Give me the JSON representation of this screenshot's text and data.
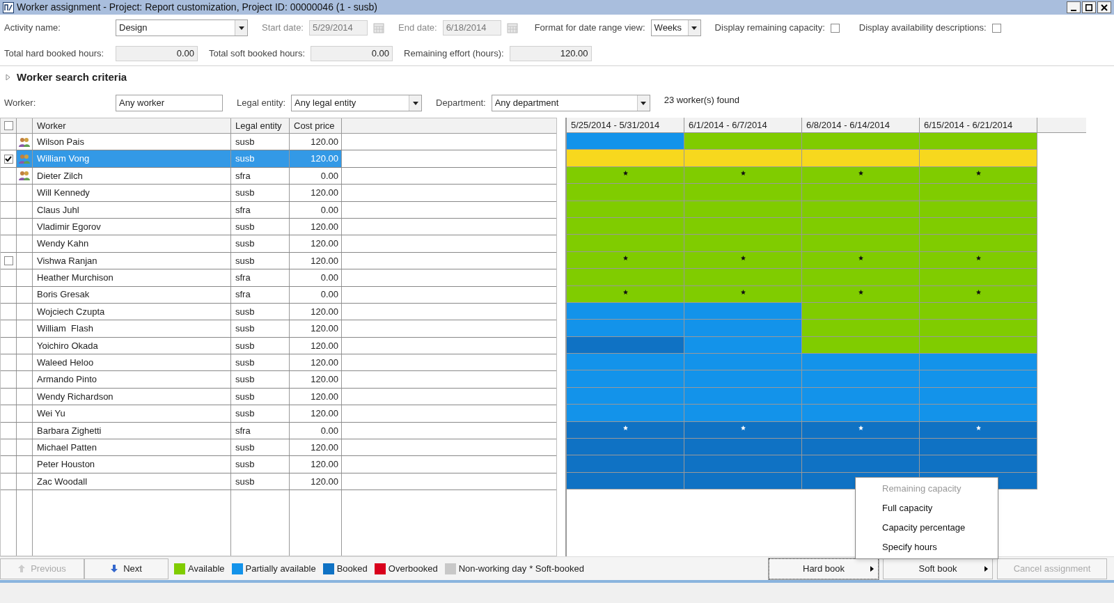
{
  "window": {
    "title": "Worker assignment - Project: Report customization, Project ID: 00000046 (1 - susb)"
  },
  "form": {
    "activity_name": {
      "label": "Activity name:",
      "value": "Design"
    },
    "start_date": {
      "label": "Start date:",
      "value": "5/29/2014"
    },
    "end_date": {
      "label": "End date:",
      "value": "6/18/2014"
    },
    "format": {
      "label": "Format for date range view:",
      "value": "Weeks"
    },
    "remaining_capacity": {
      "label": "Display remaining capacity:",
      "checked": false
    },
    "availability_descriptions": {
      "label": "Display availability descriptions:",
      "checked": false
    },
    "hard_booked": {
      "label": "Total hard booked hours:",
      "value": "0.00"
    },
    "soft_booked": {
      "label": "Total soft booked hours:",
      "value": "0.00"
    },
    "remaining_effort": {
      "label": "Remaining effort (hours):",
      "value": "120.00"
    }
  },
  "search_criteria": {
    "title": "Worker search criteria",
    "expanded": false,
    "worker": {
      "label": "Worker:",
      "value": "Any worker"
    },
    "legal_entity": {
      "label": "Legal entity:",
      "value": "Any legal entity"
    },
    "department": {
      "label": "Department:",
      "value": "Any department"
    },
    "found": "23 worker(s) found"
  },
  "table": {
    "header_checked": false,
    "columns": [
      "Worker",
      "Legal entity",
      "Cost price"
    ],
    "periods": [
      "5/25/2014 - 5/31/2014",
      "6/1/2014 - 6/7/2014",
      "6/8/2014 - 6/14/2014",
      "6/15/2014 - 6/21/2014"
    ],
    "rows": [
      {
        "worker": "Wilson Pais",
        "entity": "susb",
        "cost": "120.00",
        "has_icon": true,
        "selected": false,
        "soft_booked": false,
        "cells": [
          {
            "kind": "partial"
          },
          {
            "kind": "available"
          },
          {
            "kind": "available"
          },
          {
            "kind": "available"
          }
        ]
      },
      {
        "worker": "William Vong",
        "entity": "susb",
        "cost": "120.00",
        "has_icon": true,
        "selected": true,
        "checked": true,
        "soft_booked": false,
        "cells": [
          {
            "kind": "highlighted"
          },
          {
            "kind": "highlighted"
          },
          {
            "kind": "highlighted"
          },
          {
            "kind": "highlighted"
          }
        ]
      },
      {
        "worker": "Dieter Zilch",
        "entity": "sfra",
        "cost": "0.00",
        "has_icon": true,
        "selected": false,
        "soft_booked": true,
        "cells": [
          {
            "kind": "available"
          },
          {
            "kind": "available"
          },
          {
            "kind": "available"
          },
          {
            "kind": "available"
          }
        ]
      },
      {
        "worker": "Will Kennedy",
        "entity": "susb",
        "cost": "120.00",
        "has_icon": false,
        "selected": false,
        "soft_booked": false,
        "cells": [
          {
            "kind": "available"
          },
          {
            "kind": "available"
          },
          {
            "kind": "available"
          },
          {
            "kind": "available"
          }
        ]
      },
      {
        "worker": "Claus Juhl",
        "entity": "sfra",
        "cost": "0.00",
        "has_icon": false,
        "selected": false,
        "soft_booked": false,
        "cells": [
          {
            "kind": "available"
          },
          {
            "kind": "available"
          },
          {
            "kind": "available"
          },
          {
            "kind": "available"
          }
        ]
      },
      {
        "worker": "Vladimir Egorov",
        "entity": "susb",
        "cost": "120.00",
        "has_icon": false,
        "selected": false,
        "soft_booked": false,
        "cells": [
          {
            "kind": "available"
          },
          {
            "kind": "available"
          },
          {
            "kind": "available"
          },
          {
            "kind": "available"
          }
        ]
      },
      {
        "worker": "Wendy Kahn",
        "entity": "susb",
        "cost": "120.00",
        "has_icon": false,
        "selected": false,
        "soft_booked": false,
        "cells": [
          {
            "kind": "available"
          },
          {
            "kind": "available"
          },
          {
            "kind": "available"
          },
          {
            "kind": "available"
          }
        ]
      },
      {
        "worker": "Vishwa Ranjan",
        "entity": "susb",
        "cost": "120.00",
        "has_icon": false,
        "selected": false,
        "checked": false,
        "soft_booked": true,
        "cells": [
          {
            "kind": "available"
          },
          {
            "kind": "available"
          },
          {
            "kind": "available"
          },
          {
            "kind": "available"
          }
        ]
      },
      {
        "worker": "Heather Murchison",
        "entity": "sfra",
        "cost": "0.00",
        "has_icon": false,
        "selected": false,
        "soft_booked": false,
        "cells": [
          {
            "kind": "available"
          },
          {
            "kind": "available"
          },
          {
            "kind": "available"
          },
          {
            "kind": "available"
          }
        ]
      },
      {
        "worker": "Boris Gresak",
        "entity": "sfra",
        "cost": "0.00",
        "has_icon": false,
        "selected": false,
        "soft_booked": true,
        "cells": [
          {
            "kind": "available"
          },
          {
            "kind": "available"
          },
          {
            "kind": "available"
          },
          {
            "kind": "available"
          }
        ]
      },
      {
        "worker": "Wojciech Czupta",
        "entity": "susb",
        "cost": "120.00",
        "has_icon": false,
        "selected": false,
        "soft_booked": false,
        "cells": [
          {
            "kind": "partial"
          },
          {
            "kind": "partial"
          },
          {
            "kind": "available"
          },
          {
            "kind": "available"
          }
        ]
      },
      {
        "worker": "William  Flash",
        "entity": "susb",
        "cost": "120.00",
        "has_icon": false,
        "selected": false,
        "soft_booked": false,
        "cells": [
          {
            "kind": "partial"
          },
          {
            "kind": "partial"
          },
          {
            "kind": "available"
          },
          {
            "kind": "available"
          }
        ]
      },
      {
        "worker": "Yoichiro Okada",
        "entity": "susb",
        "cost": "120.00",
        "has_icon": false,
        "selected": false,
        "soft_booked": false,
        "cells": [
          {
            "kind": "booked"
          },
          {
            "kind": "partial"
          },
          {
            "kind": "available"
          },
          {
            "kind": "available"
          }
        ]
      },
      {
        "worker": "Waleed Heloo",
        "entity": "susb",
        "cost": "120.00",
        "has_icon": false,
        "selected": false,
        "soft_booked": false,
        "cells": [
          {
            "kind": "partial"
          },
          {
            "kind": "partial"
          },
          {
            "kind": "partial"
          },
          {
            "kind": "partial"
          }
        ]
      },
      {
        "worker": "Armando Pinto",
        "entity": "susb",
        "cost": "120.00",
        "has_icon": false,
        "selected": false,
        "soft_booked": false,
        "cells": [
          {
            "kind": "partial"
          },
          {
            "kind": "partial"
          },
          {
            "kind": "partial"
          },
          {
            "kind": "partial"
          }
        ]
      },
      {
        "worker": "Wendy Richardson",
        "entity": "susb",
        "cost": "120.00",
        "has_icon": false,
        "selected": false,
        "soft_booked": false,
        "cells": [
          {
            "kind": "partial"
          },
          {
            "kind": "partial"
          },
          {
            "kind": "partial"
          },
          {
            "kind": "partial"
          }
        ]
      },
      {
        "worker": "Wei Yu",
        "entity": "susb",
        "cost": "120.00",
        "has_icon": false,
        "selected": false,
        "soft_booked": false,
        "cells": [
          {
            "kind": "partial"
          },
          {
            "kind": "partial"
          },
          {
            "kind": "partial"
          },
          {
            "kind": "partial"
          }
        ]
      },
      {
        "worker": "Barbara Zighetti",
        "entity": "sfra",
        "cost": "0.00",
        "has_icon": false,
        "selected": false,
        "soft_booked": true,
        "cells": [
          {
            "kind": "booked"
          },
          {
            "kind": "booked"
          },
          {
            "kind": "booked"
          },
          {
            "kind": "booked"
          }
        ]
      },
      {
        "worker": "Michael Patten",
        "entity": "susb",
        "cost": "120.00",
        "has_icon": false,
        "selected": false,
        "soft_booked": false,
        "cells": [
          {
            "kind": "booked"
          },
          {
            "kind": "booked"
          },
          {
            "kind": "booked"
          },
          {
            "kind": "booked"
          }
        ]
      },
      {
        "worker": "Peter Houston",
        "entity": "susb",
        "cost": "120.00",
        "has_icon": false,
        "selected": false,
        "soft_booked": false,
        "cells": [
          {
            "kind": "booked"
          },
          {
            "kind": "booked"
          },
          {
            "kind": "booked"
          },
          {
            "kind": "booked"
          }
        ]
      },
      {
        "worker": "Zac Woodall",
        "entity": "susb",
        "cost": "120.00",
        "has_icon": false,
        "selected": false,
        "soft_booked": false,
        "cells": [
          {
            "kind": "booked"
          },
          {
            "kind": "booked"
          },
          {
            "kind": "booked"
          },
          {
            "kind": "booked"
          }
        ]
      }
    ]
  },
  "legend": [
    {
      "label": "Available",
      "color": "#80cc00"
    },
    {
      "label": "Partially available",
      "color": "#1393ea"
    },
    {
      "label": "Booked",
      "color": "#0f72c4"
    },
    {
      "label": "Overbooked",
      "color": "#d8001c"
    },
    {
      "label": "Non-working day",
      "color": "#c8c8c8"
    }
  ],
  "legend_note": "* Soft-booked",
  "buttons": [
    {
      "label": "Previous",
      "kind": "prev",
      "disabled": true
    },
    {
      "label": "Next",
      "kind": "next",
      "disabled": false
    }
  ],
  "actions": [
    {
      "label": "Hard book",
      "submenu": true,
      "disabled": false,
      "focused": true
    },
    {
      "label": "Soft book",
      "submenu": true,
      "disabled": false,
      "focused": false
    },
    {
      "label": "Cancel assignment",
      "submenu": false,
      "disabled": true,
      "focused": false
    }
  ],
  "menu": [
    {
      "label": "Remaining capacity",
      "disabled": true
    },
    {
      "label": "Full capacity",
      "disabled": false
    },
    {
      "label": "Capacity percentage",
      "disabled": false
    },
    {
      "label": "Specify hours",
      "disabled": false
    }
  ]
}
